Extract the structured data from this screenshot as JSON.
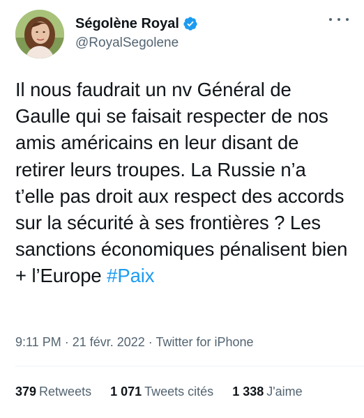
{
  "author": {
    "display_name": "Ségolène Royal",
    "handle": "@RoyalSegolene",
    "verified": true
  },
  "tweet": {
    "text": "Il nous faudrait un nv Général de Gaulle qui se faisait respecter de nos amis américains en leur disant de retirer leurs troupes. La Russie n’a t’elle pas droit aux respect des accords sur la sécurité à ses frontières ? Les sanctions économiques pénalisent bien + l’Europe ",
    "hashtag": "#Paix"
  },
  "meta": {
    "time": "9:11 PM",
    "separator1": " · ",
    "date": "21 févr. 2022",
    "separator2": " · ",
    "source": "Twitter for iPhone"
  },
  "stats": {
    "retweets_count": "379",
    "retweets_label": "Retweets",
    "quotes_count": "1 071",
    "quotes_label": "Tweets cités",
    "likes_count": "1 338",
    "likes_label": "J'aime"
  },
  "colors": {
    "accent": "#1d9bf0",
    "secondary_text": "#536471",
    "divider": "#eff3f4"
  }
}
